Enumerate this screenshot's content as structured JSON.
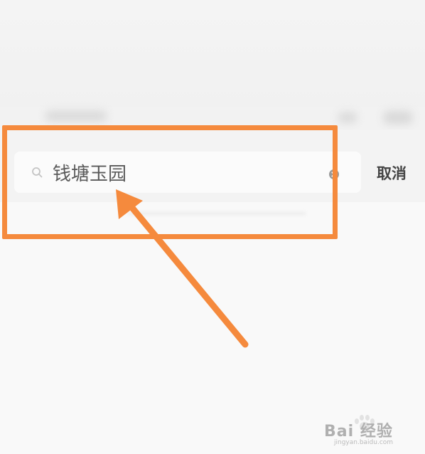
{
  "search": {
    "query": "钱塘玉园",
    "cancel_label": "取消"
  },
  "annotation": {
    "color": "#f58a3d"
  },
  "watermark": {
    "text": "Bai 经验",
    "sub": "jingyan.baidu.com"
  },
  "icons": {
    "search": "search-icon",
    "clear": "clear-icon",
    "arrow": "arrow-icon",
    "logo": "baidu-paw-icon"
  }
}
